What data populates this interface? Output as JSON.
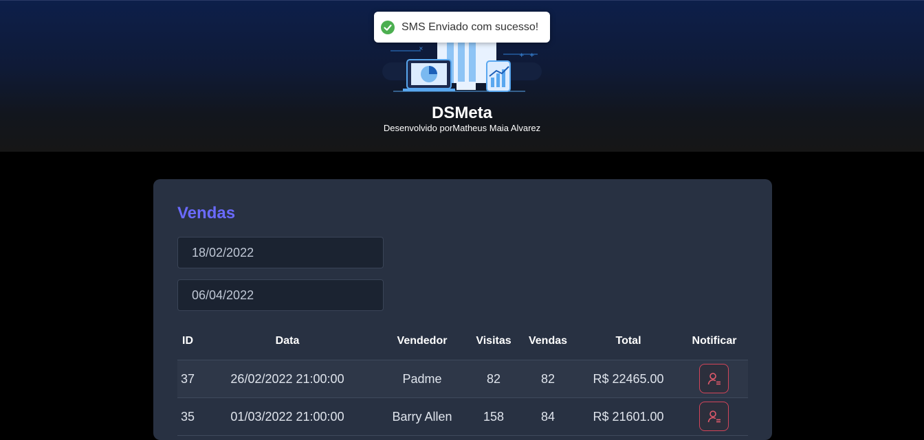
{
  "header": {
    "title": "DSMeta",
    "subtitle": "Desenvolvido porMatheus Maia Alvarez",
    "logo_icon": "dashboard-devices-illustration"
  },
  "toast": {
    "message": "SMS Enviado com sucesso!",
    "icon": "check-circle-icon",
    "color": "#4caf50"
  },
  "sales": {
    "title": "Vendas",
    "min_date": "18/02/2022",
    "max_date": "06/04/2022",
    "columns": [
      "ID",
      "Data",
      "Vendedor",
      "Visitas",
      "Vendas",
      "Total",
      "Notificar"
    ],
    "rows": [
      {
        "id": "37",
        "date": "26/02/2022 21:00:00",
        "seller": "Padme",
        "visits": "82",
        "deals": "82",
        "total": "R$ 22465.00"
      },
      {
        "id": "35",
        "date": "01/03/2022 21:00:00",
        "seller": "Barry Allen",
        "visits": "158",
        "deals": "84",
        "total": "R$ 21601.00"
      }
    ],
    "notify_icon": "user-notification-icon"
  },
  "colors": {
    "accent": "#6a6aff",
    "card_bg": "#283142",
    "notify_border": "#d4455a"
  }
}
